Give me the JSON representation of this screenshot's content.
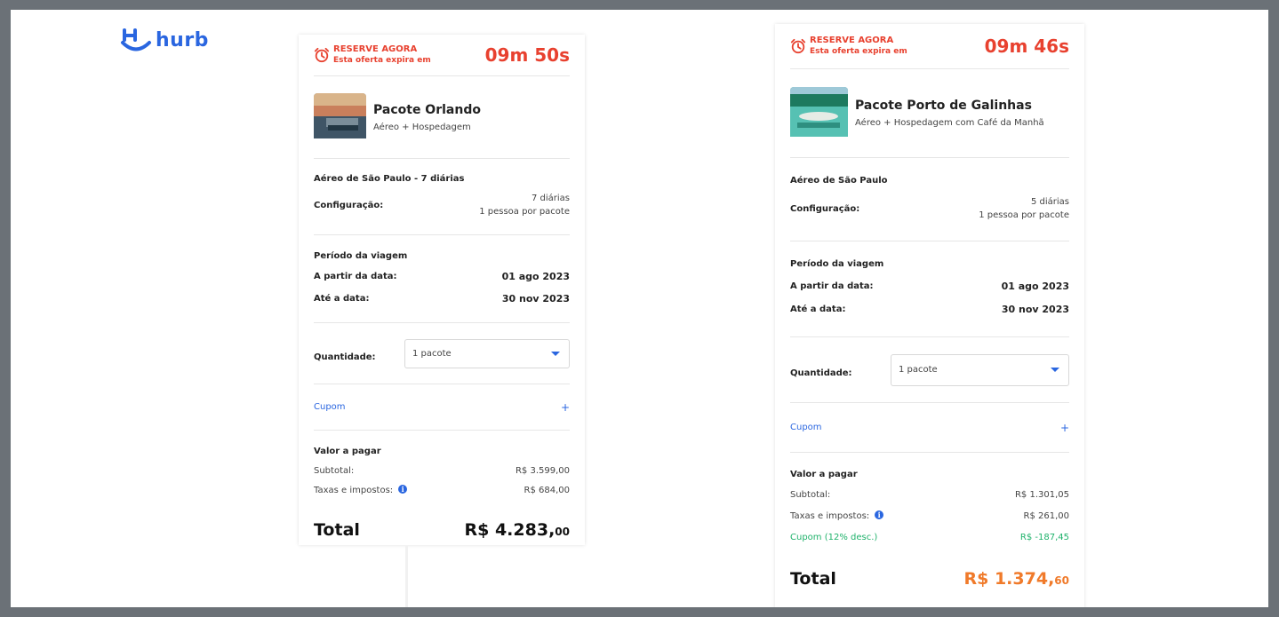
{
  "brand": {
    "logo_text": "hurb",
    "accent": "#2a66e0"
  },
  "cards": [
    {
      "reserve_title": "RESERVE AGORA",
      "reserve_sub": "Esta oferta expira em",
      "timer": "09m 50s",
      "package_title": "Pacote Orlando",
      "package_sub": "Aéreo + Hospedagem",
      "flight_title": "Aéreo de São Paulo - 7 diárias",
      "config_label": "Configuração:",
      "config_nights": "7 diárias",
      "config_people": "1 pessoa por pacote",
      "period_title": "Período da viagem",
      "from_label": "A partir da data:",
      "from_value": "01 ago 2023",
      "to_label": "Até a data:",
      "to_value": "30 nov 2023",
      "quantity_label": "Quantidade:",
      "quantity_value": "1 pacote",
      "coupon_label": "Cupom",
      "coupon_plus": "+",
      "pay_title": "Valor a pagar",
      "subtotal_label": "Subtotal:",
      "subtotal_value": "R$ 3.599,00",
      "taxes_label": "Taxas e impostos:",
      "taxes_value": "R$ 684,00",
      "info_icon": "i",
      "total_label": "Total",
      "total_main": "R$ 4.283,",
      "total_cents": "00"
    },
    {
      "reserve_title": "RESERVE AGORA",
      "reserve_sub": "Esta oferta expira em",
      "timer": "09m 46s",
      "package_title": "Pacote Porto de Galinhas",
      "package_sub": "Aéreo + Hospedagem com Café da Manhã",
      "flight_title": "Aéreo de São Paulo",
      "config_label": "Configuração:",
      "config_nights": "5 diárias",
      "config_people": "1 pessoa por pacote",
      "period_title": "Período da viagem",
      "from_label": "A partir da data:",
      "from_value": "01 ago 2023",
      "to_label": "Até a data:",
      "to_value": "30 nov 2023",
      "quantity_label": "Quantidade:",
      "quantity_value": "1 pacote",
      "coupon_label": "Cupom",
      "coupon_plus": "+",
      "pay_title": "Valor a pagar",
      "subtotal_label": "Subtotal:",
      "subtotal_value": "R$ 1.301,05",
      "taxes_label": "Taxas e impostos:",
      "taxes_value": "R$ 261,00",
      "info_icon": "i",
      "discount_label": "Cupom (12% desc.)",
      "discount_value": "R$ -187,45",
      "total_label": "Total",
      "total_main": "R$ 1.374,",
      "total_cents": "60"
    }
  ],
  "colors": {
    "timer": "#e8412f",
    "discount": "#1fb26b",
    "total_highlight": "#f07a2a"
  }
}
